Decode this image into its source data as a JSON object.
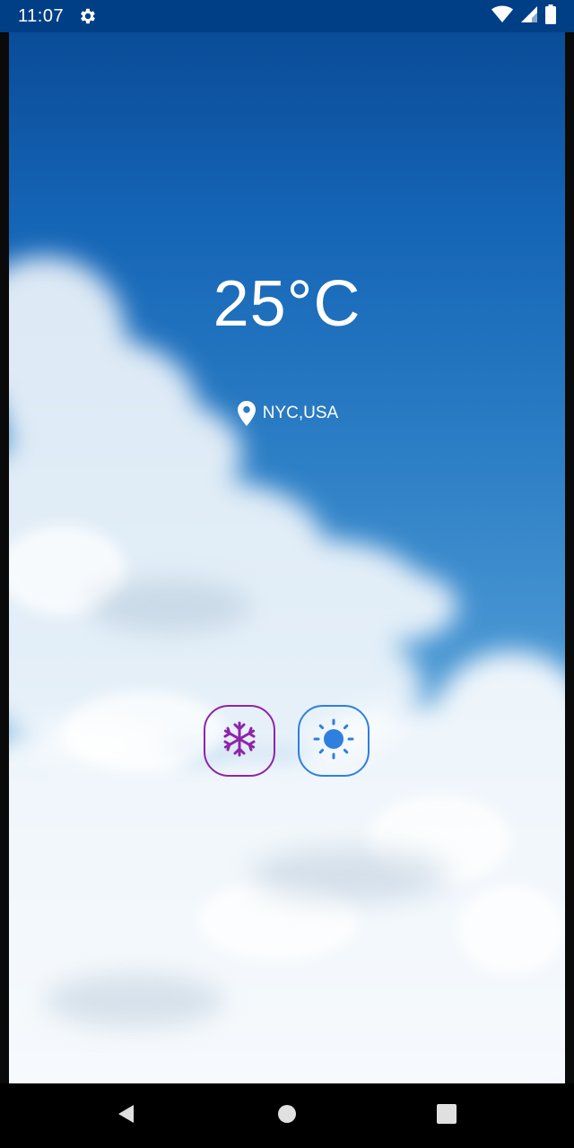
{
  "status_bar": {
    "time": "11:07",
    "icons": [
      "settings-gear-icon",
      "wifi-icon",
      "cell-signal-icon",
      "battery-icon"
    ]
  },
  "weather": {
    "temperature": "25°C",
    "location": "NYC,USA"
  },
  "mode_buttons": [
    {
      "name": "snowflake-icon",
      "color": "#8e24aa"
    },
    {
      "name": "sun-icon",
      "color": "#2f7fe0"
    }
  ],
  "nav_bar": {
    "icons": [
      "back-icon",
      "home-icon",
      "recents-icon"
    ]
  },
  "colors": {
    "status_bar_bg": "#003f86",
    "sky_top": "#0a4c98",
    "sky_bottom": "#a9cdee",
    "snow_accent": "#8e24aa",
    "sun_accent": "#2f7fe0"
  }
}
